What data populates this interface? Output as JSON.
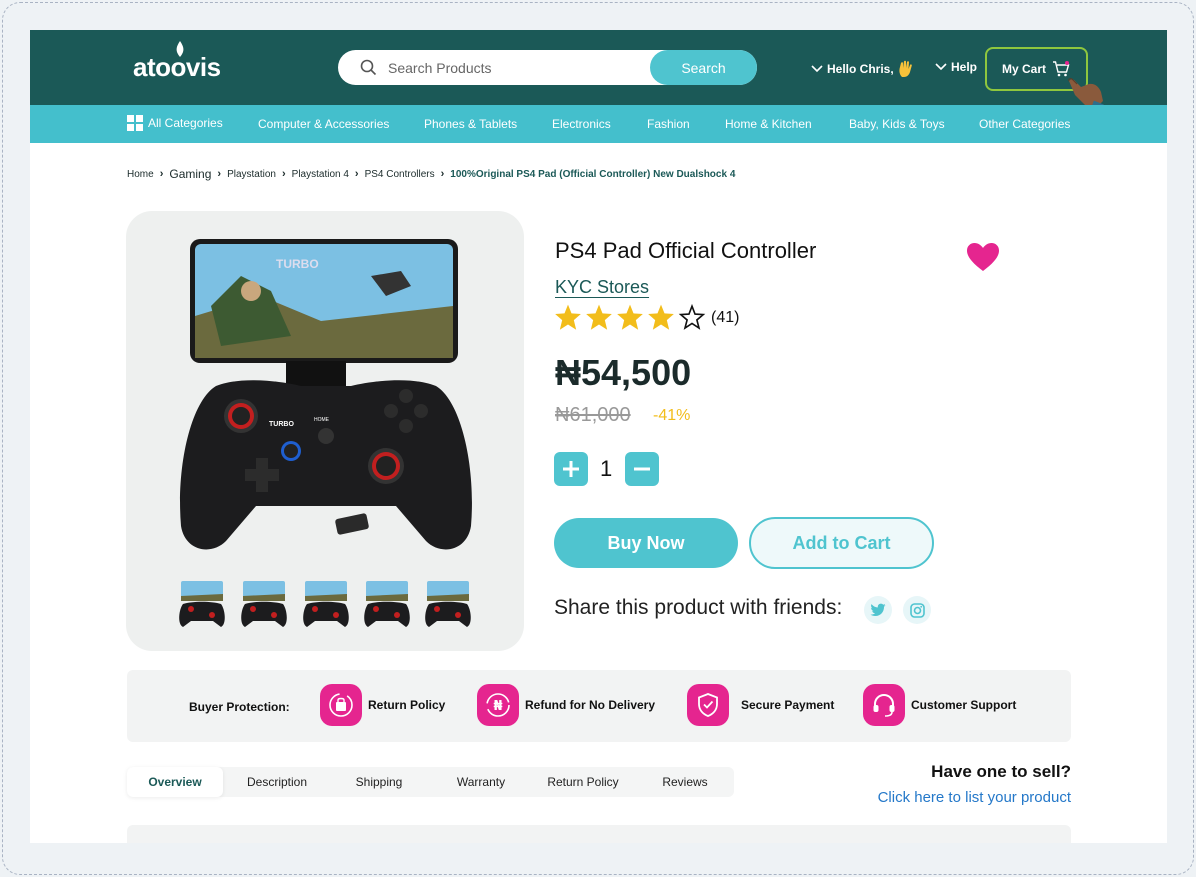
{
  "header": {
    "logo": "atoovis",
    "search_placeholder": "Search Products",
    "search_button": "Search",
    "greeting": "Hello Chris,",
    "help": "Help",
    "cart": "My Cart"
  },
  "nav": {
    "items": [
      "All Categories",
      "Computer & Accessories",
      "Phones & Tablets",
      "Electronics",
      "Fashion",
      "Home & Kitchen",
      "Baby, Kids & Toys",
      "Other Categories"
    ]
  },
  "breadcrumb": [
    "Home",
    "Gaming",
    "Playstation",
    "Playstation 4",
    "PS4 Controllers",
    "100%Original PS4 Pad (Official Controller) New Dualshock 4"
  ],
  "product": {
    "title": "PS4 Pad Official Controller",
    "store": "KYC Stores",
    "rating": 4,
    "rating_max": 5,
    "rating_count": "(41)",
    "price": "₦54,500",
    "old_price": "₦61,000",
    "discount": "-41%",
    "quantity": "1",
    "buy_now": "Buy Now",
    "add_to_cart": "Add to Cart",
    "share_text": "Share this product with friends:"
  },
  "protection": {
    "label": "Buyer Protection:",
    "items": [
      "Return Policy",
      "Refund for No Delivery",
      "Secure Payment",
      "Customer Support"
    ]
  },
  "tabs": [
    "Overview",
    "Description",
    "Shipping",
    "Warranty",
    "Return Policy",
    "Reviews"
  ],
  "sell": {
    "heading": "Have one to sell?",
    "link": "Click here to list your product"
  },
  "colors": {
    "header": "#1b5957",
    "nav": "#44bfcc",
    "accent": "#4fc4cf",
    "pink": "#e5258f",
    "star": "#f2bd1b"
  }
}
